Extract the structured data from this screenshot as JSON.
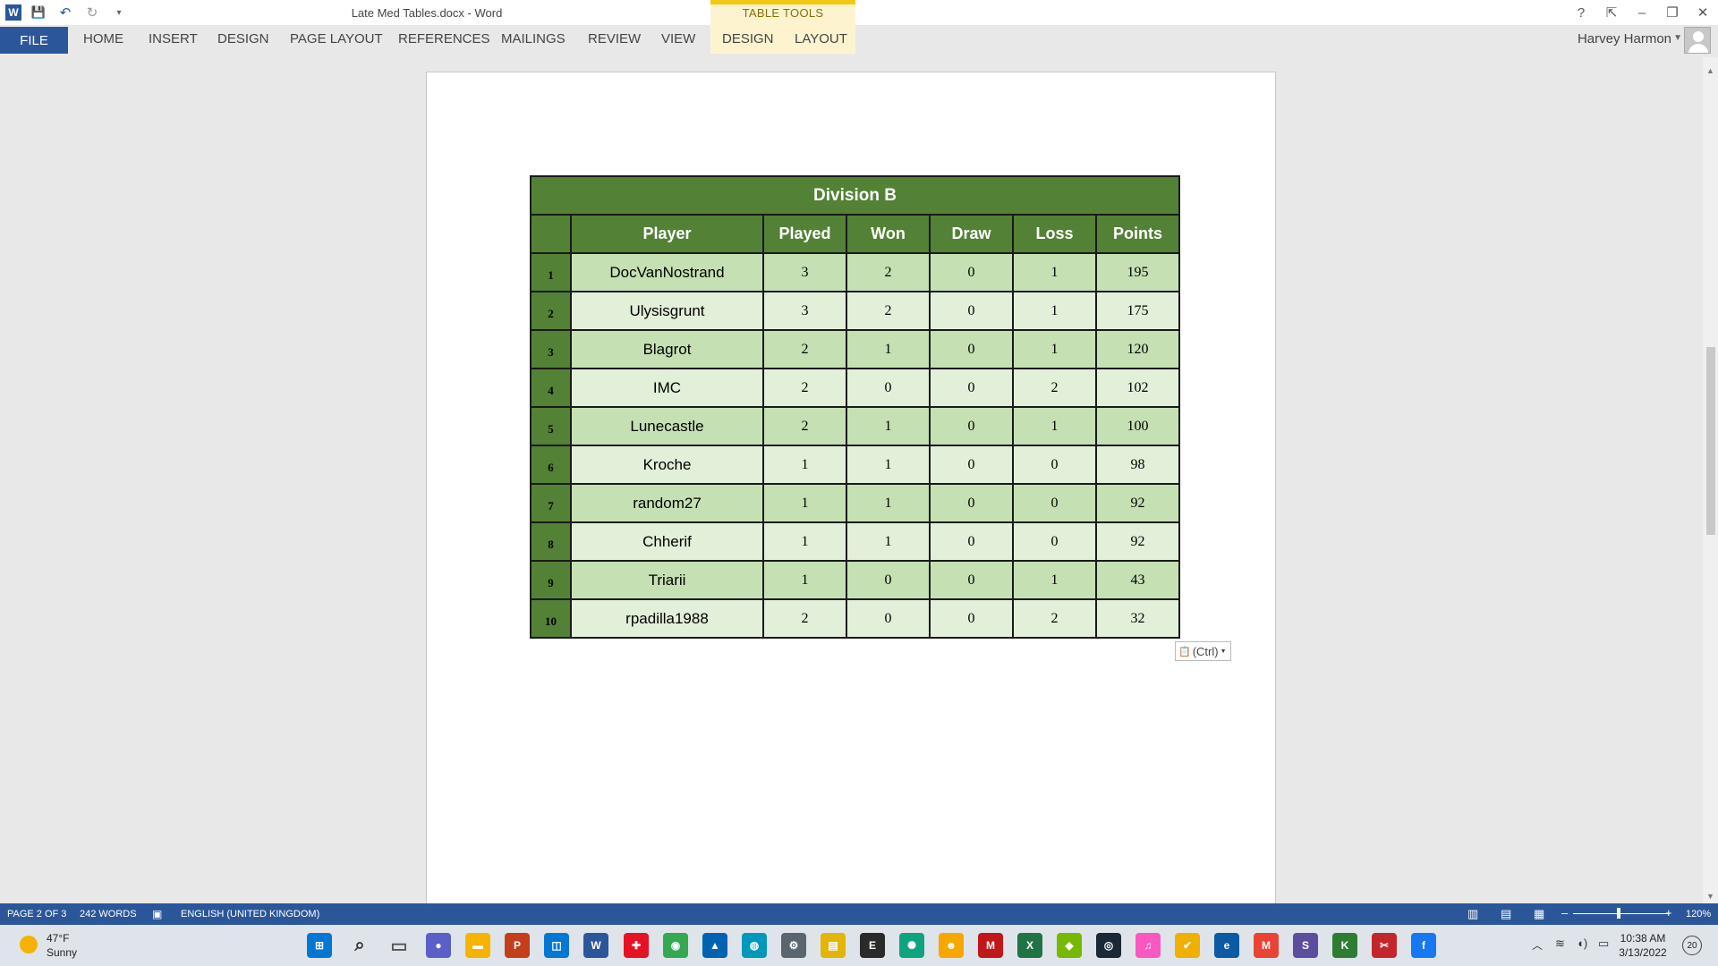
{
  "window": {
    "title": "Late Med Tables.docx - Word",
    "user_name": "Harvey Harmon",
    "help": "?",
    "minimize": "–",
    "restore": "❐",
    "close": "✕"
  },
  "qat": {
    "word_icon": "W",
    "save_icon": "💾",
    "undo_icon": "↶",
    "redo_icon": "↻",
    "customize_icon": "▾"
  },
  "contextual": {
    "label": "TABLE TOOLS"
  },
  "ribbon": {
    "file": "FILE",
    "tabs": [
      "HOME",
      "INSERT",
      "DESIGN",
      "PAGE LAYOUT",
      "REFERENCES",
      "MAILINGS",
      "REVIEW",
      "VIEW"
    ],
    "context_tabs": [
      "DESIGN",
      "LAYOUT"
    ]
  },
  "table": {
    "title": "Division B",
    "headers": [
      "",
      "Player",
      "Played",
      "Won",
      "Draw",
      "Loss",
      "Points"
    ],
    "rows": [
      [
        "1",
        "DocVanNostrand",
        "3",
        "2",
        "0",
        "1",
        "195"
      ],
      [
        "2",
        "Ulysisgrunt",
        "3",
        "2",
        "0",
        "1",
        "175"
      ],
      [
        "3",
        "Blagrot",
        "2",
        "1",
        "0",
        "1",
        "120"
      ],
      [
        "4",
        "IMC",
        "2",
        "0",
        "0",
        "2",
        "102"
      ],
      [
        "5",
        "Lunecastle",
        "2",
        "1",
        "0",
        "1",
        "100"
      ],
      [
        "6",
        "Kroche",
        "1",
        "1",
        "0",
        "0",
        "98"
      ],
      [
        "7",
        "random27",
        "1",
        "1",
        "0",
        "0",
        "92"
      ],
      [
        "8",
        "Chherif",
        "1",
        "1",
        "0",
        "0",
        "92"
      ],
      [
        "9",
        "Triarii",
        "1",
        "0",
        "0",
        "1",
        "43"
      ],
      [
        "10",
        "rpadilla1988",
        "2",
        "0",
        "0",
        "2",
        "32"
      ]
    ]
  },
  "paste_options": {
    "label": "(Ctrl)",
    "icon": "📋"
  },
  "status": {
    "page": "PAGE 2 OF 3",
    "words": "242 WORDS",
    "language": "ENGLISH (UNITED KINGDOM)",
    "zoom": "120%",
    "zoom_minus": "–",
    "zoom_plus": "+"
  },
  "taskbar": {
    "weather_temp": "47°F",
    "weather_cond": "Sunny",
    "time": "10:38 AM",
    "date": "3/13/2022",
    "notifications": "20",
    "apps": [
      {
        "name": "start-icon",
        "glyph": "⊞",
        "color": "#0078d4"
      },
      {
        "name": "search-icon",
        "glyph": "⌕",
        "color": "#333333"
      },
      {
        "name": "task-view-icon",
        "glyph": "▭",
        "color": "#555555"
      },
      {
        "name": "teams-chat-icon",
        "glyph": "●",
        "color": "#5b5fc7"
      },
      {
        "name": "file-explorer-icon",
        "glyph": "▬",
        "color": "#f4b400"
      },
      {
        "name": "powerpoint-icon",
        "glyph": "P",
        "color": "#c43e1c"
      },
      {
        "name": "store-icon",
        "glyph": "◫",
        "color": "#0078d4"
      },
      {
        "name": "word-icon",
        "glyph": "W",
        "color": "#2b579a"
      },
      {
        "name": "gift-icon",
        "glyph": "✚",
        "color": "#e81123"
      },
      {
        "name": "chrome-icon",
        "glyph": "◉",
        "color": "#34a853"
      },
      {
        "name": "photos-icon",
        "glyph": "▲",
        "color": "#0063b1"
      },
      {
        "name": "tips-icon",
        "glyph": "◍",
        "color": "#0099bc"
      },
      {
        "name": "settings-icon",
        "glyph": "⚙",
        "color": "#5a6570"
      },
      {
        "name": "sticky-notes-icon",
        "glyph": "▤",
        "color": "#e3b505"
      },
      {
        "name": "epic-games-icon",
        "glyph": "E",
        "color": "#2a2a2a"
      },
      {
        "name": "chatgpt-icon",
        "glyph": "✺",
        "color": "#10a37f"
      },
      {
        "name": "app-face-icon",
        "glyph": "☻",
        "color": "#f6a800"
      },
      {
        "name": "mcafee-icon",
        "glyph": "M",
        "color": "#c01818"
      },
      {
        "name": "excel-icon",
        "glyph": "X",
        "color": "#217346"
      },
      {
        "name": "nvidia-icon",
        "glyph": "◆",
        "color": "#76b900"
      },
      {
        "name": "steam-icon",
        "glyph": "◎",
        "color": "#1b2838"
      },
      {
        "name": "itunes-icon",
        "glyph": "♫",
        "color": "#fa57c1"
      },
      {
        "name": "norton-icon",
        "glyph": "✔",
        "color": "#f0b000"
      },
      {
        "name": "edge-icon",
        "glyph": "e",
        "color": "#0c59a4"
      },
      {
        "name": "gmail-icon",
        "glyph": "M",
        "color": "#ea4335"
      },
      {
        "name": "sway-icon",
        "glyph": "S",
        "color": "#5c4d9e"
      },
      {
        "name": "k-app-icon",
        "glyph": "K",
        "color": "#2e7d32"
      },
      {
        "name": "snip-icon",
        "glyph": "✂",
        "color": "#c4262e"
      },
      {
        "name": "facebook-icon",
        "glyph": "f",
        "color": "#1877f2"
      }
    ]
  }
}
